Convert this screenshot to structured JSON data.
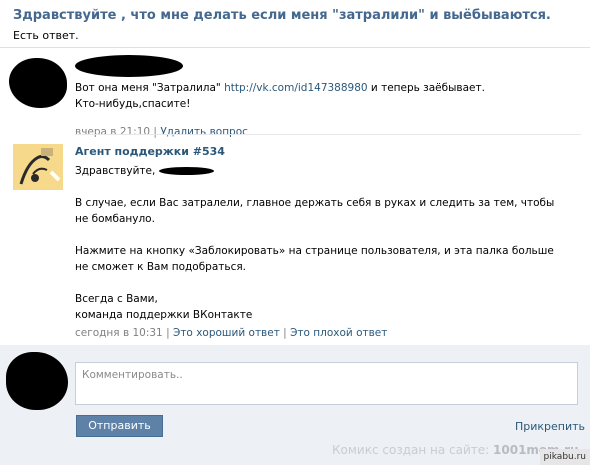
{
  "header": {
    "title": "Здравствуйте , что мне делать если меня \"затралили\" и выёбываются.",
    "status": "Есть ответ."
  },
  "question": {
    "text_before": "Вот она меня \"Затралила\" ",
    "link": "http://vk.com/id147388980",
    "text_after": " и теперь заёбывает. Кто-нибудь,спасите!",
    "time": "вчера в 21:10",
    "separator": "|",
    "delete_label": "Удалить вопрос"
  },
  "answer": {
    "agent_name": "Агент поддержки #534",
    "greeting": "Здравствуйте,",
    "paragraph1": "В случае, если Вас затралели, главное держать себя в руках и следить за тем, чтобы не бомбануло.",
    "paragraph2": "Нажмите на кнопку «Заблокировать» на странице пользователя, и эта палка больше не сможет к Вам подобраться.",
    "sign1": "Всегда с Вами,",
    "sign2": "команда поддержки ВКонтакте",
    "time": "сегодня в 10:31",
    "separator": "|",
    "good_label": "Это хороший ответ",
    "bad_label": "Это плохой ответ"
  },
  "comment": {
    "placeholder": "Комментировать..",
    "send_label": "Отправить",
    "attach_label": "Прикрепить"
  },
  "watermark": {
    "prefix": "Комикс создан на сайте:",
    "site": "1001mem.ru"
  },
  "pikabu_label": "pikabu.ru"
}
